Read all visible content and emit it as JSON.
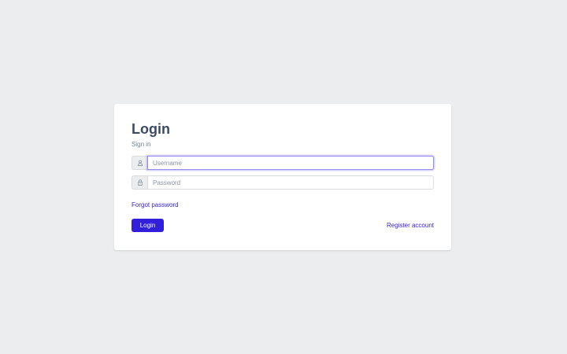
{
  "login": {
    "title": "Login",
    "subtitle": "Sign in",
    "username": {
      "placeholder": "Username",
      "value": "",
      "icon": "user-icon"
    },
    "password": {
      "placeholder": "Password",
      "value": "",
      "icon": "lock-icon"
    },
    "forgot_label": "Forgot password",
    "login_label": "Login",
    "register_label": "Register account"
  },
  "colors": {
    "background": "#ebedef",
    "card": "#ffffff",
    "primary": "#321fdb",
    "heading": "#3c4b64",
    "muted": "#768192"
  }
}
